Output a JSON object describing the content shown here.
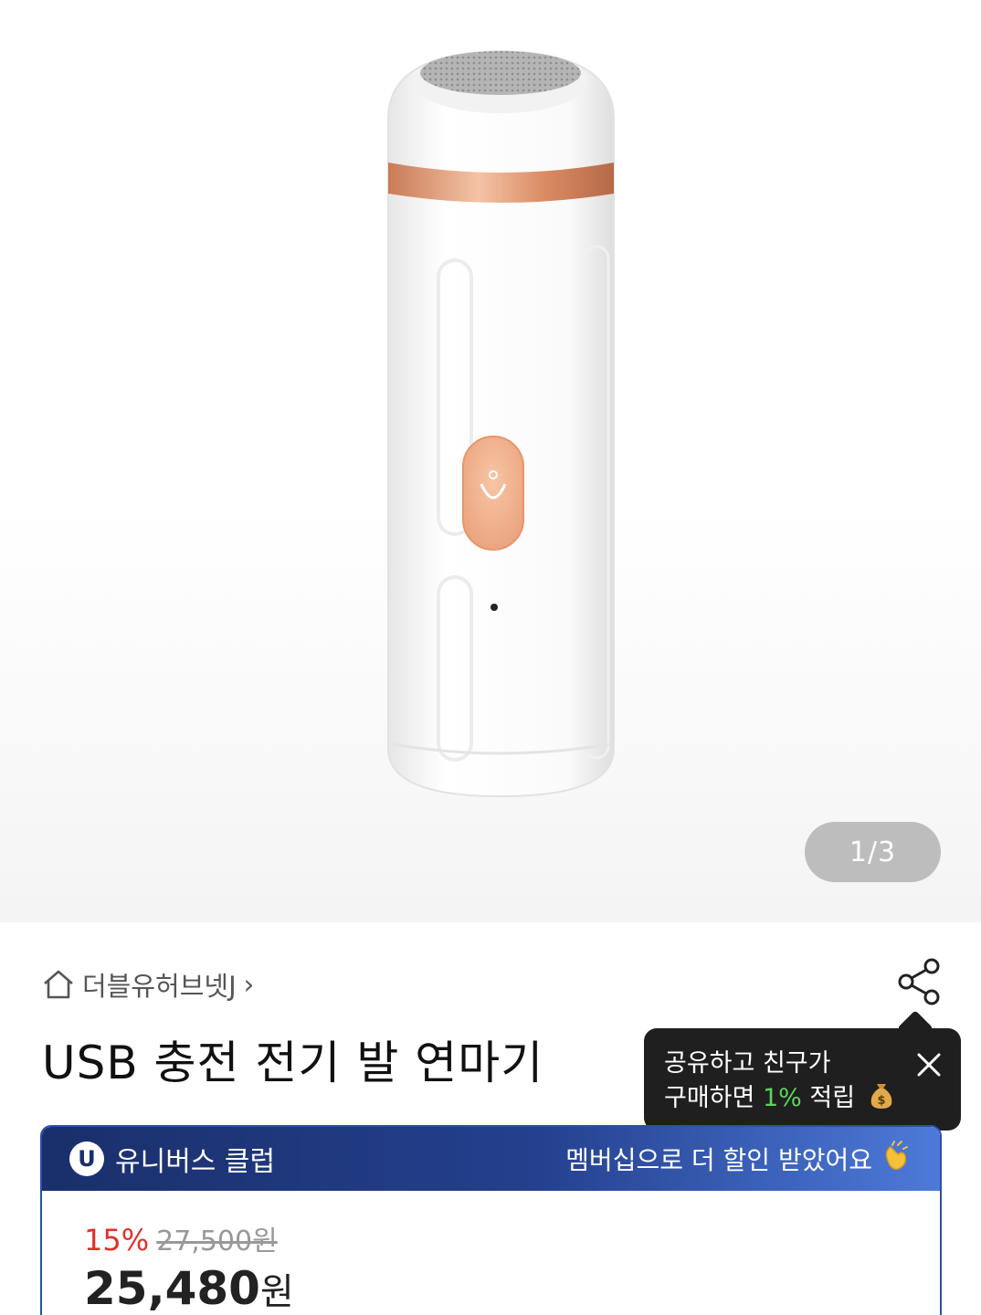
{
  "gallery": {
    "current_page": "1",
    "separator": "/",
    "total_pages": "3"
  },
  "breadcrumb": {
    "store_name": "더블유허브넷J",
    "chevron": "›"
  },
  "product": {
    "title": "USB 충전 전기 발 연마기"
  },
  "share_tooltip": {
    "line1": "공유하고 친구가",
    "line2_prefix": "구매하면 ",
    "line2_percent": "1%",
    "line2_suffix": " 적립"
  },
  "club": {
    "badge": "U",
    "name": "유니버스 클럽",
    "message": "멤버십으로 더 할인 받았어요"
  },
  "pricing": {
    "discount_rate": "15%",
    "original_price": "27,500원",
    "sale_amount": "25,480",
    "sale_unit": "원"
  },
  "colors": {
    "discount": "#e0312b",
    "club_header": "#24408e",
    "tooltip_bg": "#1f1f1f",
    "tooltip_accent": "#5ed35e"
  }
}
